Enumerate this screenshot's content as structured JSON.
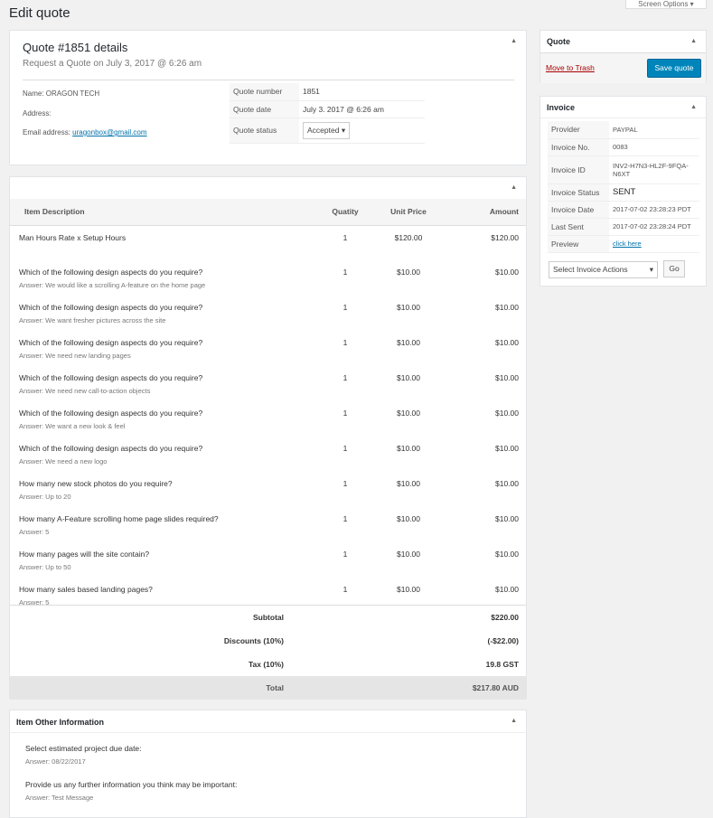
{
  "page_title": "Edit quote",
  "screen_options": "Screen Options ▾",
  "details": {
    "title": "Quote #1851 details",
    "subtitle": "Request a Quote on July 3, 2017 @ 6:26 am",
    "name_label": "Name:",
    "name": "ORAGON TECH",
    "address_label": "Address:",
    "email_label": "Email address:",
    "email": "uragonbox@gmail.com",
    "rows": [
      {
        "k": "Quote number",
        "v": "1851"
      },
      {
        "k": "Quote date",
        "v": "July 3. 2017 @ 6:26 am"
      },
      {
        "k": "Quote status",
        "v": "Accepted"
      }
    ]
  },
  "items": {
    "headers": [
      "Item Description",
      "Quatity",
      "Unit Price",
      "Amount"
    ],
    "rows": [
      {
        "d": "Man Hours Rate x Setup Hours",
        "a": "",
        "q": "1",
        "p": "$120.00",
        "t": "$120.00"
      },
      {
        "d": "Which of the following design aspects do you require?",
        "a": "Answer: We would like a scrolling A-feature on the home page",
        "q": "1",
        "p": "$10.00",
        "t": "$10.00"
      },
      {
        "d": "Which of the following design aspects do you require?",
        "a": "Answer: We want fresher pictures across the site",
        "q": "1",
        "p": "$10.00",
        "t": "$10.00"
      },
      {
        "d": "Which of the following design aspects do you require?",
        "a": "Answer: We need new landing pages",
        "q": "1",
        "p": "$10.00",
        "t": "$10.00"
      },
      {
        "d": "Which of the following design aspects do you require?",
        "a": "Answer: We need new call-to-action objects",
        "q": "1",
        "p": "$10.00",
        "t": "$10.00"
      },
      {
        "d": "Which of the following design aspects do you require?",
        "a": "Answer: We want a new look & feel",
        "q": "1",
        "p": "$10.00",
        "t": "$10.00"
      },
      {
        "d": "Which of the following design aspects do you require?",
        "a": "Answer: We need a new logo",
        "q": "1",
        "p": "$10.00",
        "t": "$10.00"
      },
      {
        "d": "How many new stock photos do you require?",
        "a": "Answer: Up to 20",
        "q": "1",
        "p": "$10.00",
        "t": "$10.00"
      },
      {
        "d": "How many A-Feature scrolling home page slides required?",
        "a": "Answer: 5",
        "q": "1",
        "p": "$10.00",
        "t": "$10.00"
      },
      {
        "d": "How many pages will the site contain?",
        "a": "Answer: Up to 50",
        "q": "1",
        "p": "$10.00",
        "t": "$10.00"
      },
      {
        "d": "How many sales based landing pages?",
        "a": "Answer: 5",
        "q": "1",
        "p": "$10.00",
        "t": "$10.00"
      }
    ],
    "totals": [
      {
        "k": "Subtotal",
        "v": "$220.00"
      },
      {
        "k": "Discounts (10%)",
        "v": "(-$22.00)"
      },
      {
        "k": "Tax (10%)",
        "v": "19.8 GST"
      },
      {
        "k": "Total",
        "v": "$217.80 AUD"
      }
    ]
  },
  "other": {
    "title": "Item Other Information",
    "rows": [
      {
        "q": "Select estimated project due date:",
        "a": "Answer: 08/22/2017"
      },
      {
        "q": "Provide us any further information you think may be important:",
        "a": "Answer: Test Message"
      }
    ]
  },
  "quote_box": {
    "title": "Quote",
    "trash": "Move to Trash",
    "save": "Save quote"
  },
  "invoice": {
    "title": "Invoice",
    "rows": [
      {
        "k": "Provider",
        "v": "PAYPAL"
      },
      {
        "k": "Invoice No.",
        "v": "0083"
      },
      {
        "k": "Invoice ID",
        "v": "INV2-H7N3-HL2F-9FQA-N6XT"
      },
      {
        "k": "Invoice Status",
        "v": "SENT"
      },
      {
        "k": "Invoice Date",
        "v": "2017-07-02 23:28:23 PDT"
      },
      {
        "k": "Last Sent",
        "v": "2017-07-02 23:28:24 PDT"
      },
      {
        "k": "Preview",
        "v": "click here"
      }
    ],
    "actions": "Select Invoice Actions",
    "go": "Go"
  },
  "colors": {
    "primary": "#0073aa",
    "trash": "#a00"
  }
}
